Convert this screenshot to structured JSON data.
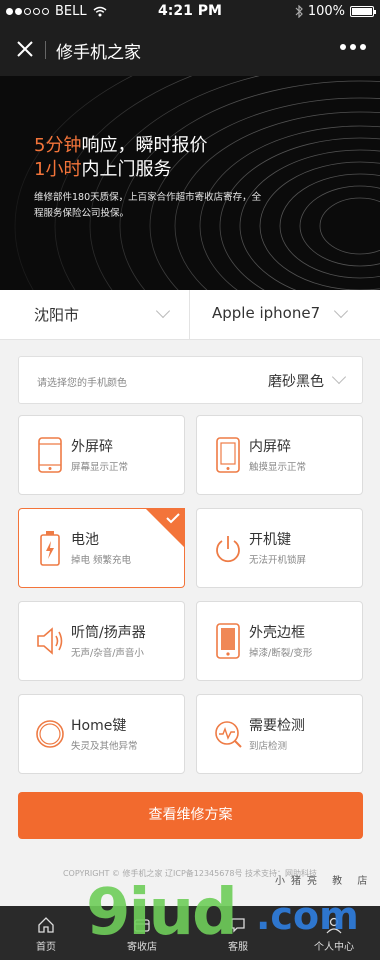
{
  "status_bar": {
    "carrier": "BELL",
    "time": "4:21 PM",
    "battery": "100%"
  },
  "nav": {
    "title": "修手机之家"
  },
  "banner": {
    "line1_highlight": "5分钟",
    "line1_rest": "响应，瞬时报价",
    "line2_highlight": "1小时",
    "line2_rest": "内上门服务",
    "subtitle": "维修部件180天质保，上百家合作超市寄收店寄存，全程服务保险公司投保。"
  },
  "location": {
    "city": "沈阳市",
    "model": "Apple  iphone7"
  },
  "color_select": {
    "placeholder": "请选择您的手机颜色",
    "value": "磨砂黑色"
  },
  "issues": [
    {
      "name": "外屏碎",
      "desc": "屏幕显示正常",
      "icon": "phone-cracked-screen-icon",
      "selected": false
    },
    {
      "name": "内屏碎",
      "desc": "触摸显示正常",
      "icon": "phone-inner-screen-icon",
      "selected": false
    },
    {
      "name": "电池",
      "desc": "掉电  频繁充电",
      "icon": "battery-icon",
      "selected": true
    },
    {
      "name": "开机键",
      "desc": "无法开机锁屏",
      "icon": "power-icon",
      "selected": false
    },
    {
      "name": "听筒/扬声器",
      "desc": "无声/杂音/声音小",
      "icon": "speaker-icon",
      "selected": false
    },
    {
      "name": "外壳边框",
      "desc": "掉漆/断裂/变形",
      "icon": "phone-frame-icon",
      "selected": false
    },
    {
      "name": "Home键",
      "desc": "失灵及其他异常",
      "icon": "home-button-icon",
      "selected": false
    },
    {
      "name": "需要检测",
      "desc": "到店检测",
      "icon": "diagnose-icon",
      "selected": false
    }
  ],
  "cta": {
    "label": "查看维修方案"
  },
  "footer": {
    "copyright": "COPYRIGHT © 修手机之家 辽ICP备12345678号  技术支持：网助科技"
  },
  "tabbar": [
    {
      "label": "首页",
      "icon": "home-icon"
    },
    {
      "label": "寄收店",
      "icon": "store-icon"
    },
    {
      "label": "",
      "icon": ""
    },
    {
      "label": "客服",
      "icon": "chat-icon"
    },
    {
      "label": "个人中心",
      "icon": "user-icon"
    }
  ],
  "watermark": {
    "big": "9iud",
    "domain": ".com",
    "chinese": "小猪亮  教  店"
  },
  "colors": {
    "accent": "#f26a2e",
    "dark": "#1e1e1e",
    "card_border": "#dcdcdc"
  }
}
